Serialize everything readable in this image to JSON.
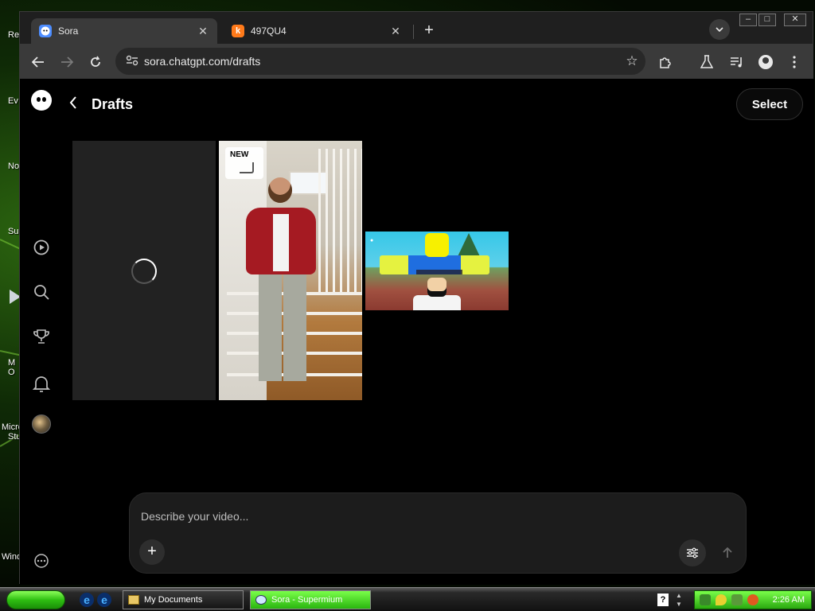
{
  "desktop": {
    "labels": [
      "Re",
      "Ev",
      "No",
      "Su",
      "M",
      "O",
      "Micro",
      "Stu",
      "Wind"
    ]
  },
  "browser": {
    "tabs": [
      {
        "title": "Sora",
        "icon": "sora-icon",
        "active": true
      },
      {
        "title": "497QU4",
        "icon": "k-icon",
        "active": false
      }
    ],
    "address": "sora.chatgpt.com/drafts"
  },
  "page": {
    "title": "Drafts",
    "select_label": "Select",
    "drafts": [
      {
        "state": "loading"
      },
      {
        "badge": "NEW",
        "thumbnail": "person-on-stairs"
      },
      {
        "thumbnail": "roblox-scene"
      }
    ],
    "composer": {
      "placeholder": "Describe your video..."
    },
    "sidebar_icons": [
      "video-feed-icon",
      "search-icon",
      "trophy-icon",
      "bell-icon",
      "profile-avatar"
    ]
  },
  "taskbar": {
    "tasks": [
      {
        "label": "My Documents"
      },
      {
        "label": "Sora - Supermium"
      }
    ],
    "clock": "2:26 AM"
  },
  "colors": {
    "page_bg": "#000000",
    "tab_active": "#3a3a3a",
    "composer_bg": "#1c1c1c",
    "taskbar_green": "#2fbf12"
  }
}
